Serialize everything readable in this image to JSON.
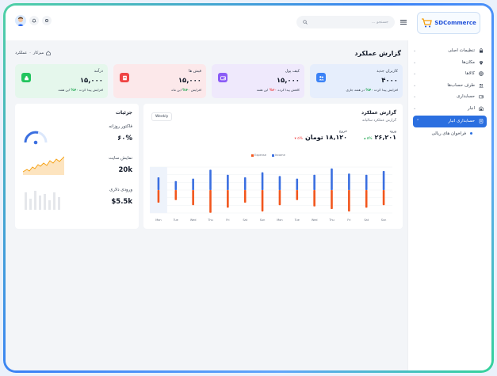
{
  "brand": {
    "name": "SDCommerce"
  },
  "header": {
    "search_placeholder": "جستجو ..."
  },
  "sidebar": {
    "items": [
      {
        "label": "تنظیمات اصلی",
        "icon": "lock-icon"
      },
      {
        "label": "مکان‌ها",
        "icon": "map-pin-icon"
      },
      {
        "label": "کالاها",
        "icon": "globe-icon"
      },
      {
        "label": "طرف حساب‌ها",
        "icon": "users-icon"
      },
      {
        "label": "حسابداری",
        "icon": "wallet-icon"
      },
      {
        "label": "انبار",
        "icon": "warehouse-icon"
      }
    ],
    "active_item": {
      "label": "حسابداری انبار",
      "icon": "ledger-icon"
    },
    "sub_items": [
      {
        "label": "فراخوان های ریالی"
      }
    ]
  },
  "page": {
    "title": "گزارش عملکرد",
    "breadcrumb": {
      "home": "میزکار",
      "separator": "·",
      "current": "عملکرد"
    }
  },
  "cards": [
    {
      "title": "کاربران جدید",
      "value": "۴۰۰۰",
      "note_prefix": "افزایش پیدا کرده",
      "change": "۴۰%",
      "note_suffix": "در هفته جاری",
      "trend": "up",
      "bg": "#e6eefc",
      "icon_bg": "#3b82f6",
      "icon": "users-icon"
    },
    {
      "title": "کیف پول",
      "value": "۱۵,۰۰۰",
      "note_prefix": "کاهش پیدا کرده",
      "change": "۲۰%",
      "note_suffix": "این هفته",
      "trend": "down",
      "bg": "#efe9fc",
      "icon_bg": "#8b5cf6",
      "icon": "wallet-icon"
    },
    {
      "title": "فیش ها",
      "value": "۱۵,۰۰۰",
      "note_prefix": "افزایش",
      "change": "۴۰%",
      "note_suffix": "این ماه",
      "trend": "up",
      "bg": "#fce8ea",
      "icon_bg": "#ef4444",
      "icon": "receipt-icon"
    },
    {
      "title": "درآمد",
      "value": "۱۵,۰۰۰",
      "note_prefix": "افزایش پیدا کرده",
      "change": "۴۰%",
      "note_suffix": "این هفته",
      "trend": "up",
      "bg": "#e5f7ec",
      "icon_bg": "#22c55e",
      "icon": "money-bag-icon"
    }
  ],
  "performance": {
    "title": "گزارش عملکرد",
    "subtitle": "گزارش عملکرد سالیانه",
    "period_button": "Weekly",
    "income": {
      "label": "ورود",
      "value": "۲۶,۲۰۱",
      "change": "۵%"
    },
    "outgo": {
      "label": "خروج",
      "value": "۱۸,۱۲۰ تومان",
      "change": "۵%"
    }
  },
  "details": {
    "title": "جزئیات",
    "stats": [
      {
        "label": "فاکتور روزانه",
        "value": "۶۰%"
      },
      {
        "label": "نمایش سایت",
        "value": "20k"
      },
      {
        "label": "ورودی دلاری",
        "value": "$5.5k"
      }
    ]
  },
  "chart_data": {
    "type": "bar",
    "categories": [
      "Mon",
      "Tue",
      "Wed",
      "Thu",
      "Fri",
      "Sat",
      "Sun",
      "Mon",
      "Tue",
      "Wed",
      "Thu",
      "Fri",
      "Sat",
      "Sun"
    ],
    "series": [
      {
        "name": "Income",
        "color": "#3b6fe0",
        "values": [
          20,
          14,
          18,
          32,
          24,
          20,
          28,
          22,
          18,
          24,
          34,
          26,
          24,
          30
        ]
      },
      {
        "name": "Expense",
        "color": "#f2561d",
        "values": [
          -20,
          -16,
          -24,
          -36,
          -28,
          -20,
          -34,
          -24,
          -16,
          -26,
          -30,
          -34,
          -28,
          -24
        ]
      }
    ],
    "legend": "top",
    "grid": true
  }
}
